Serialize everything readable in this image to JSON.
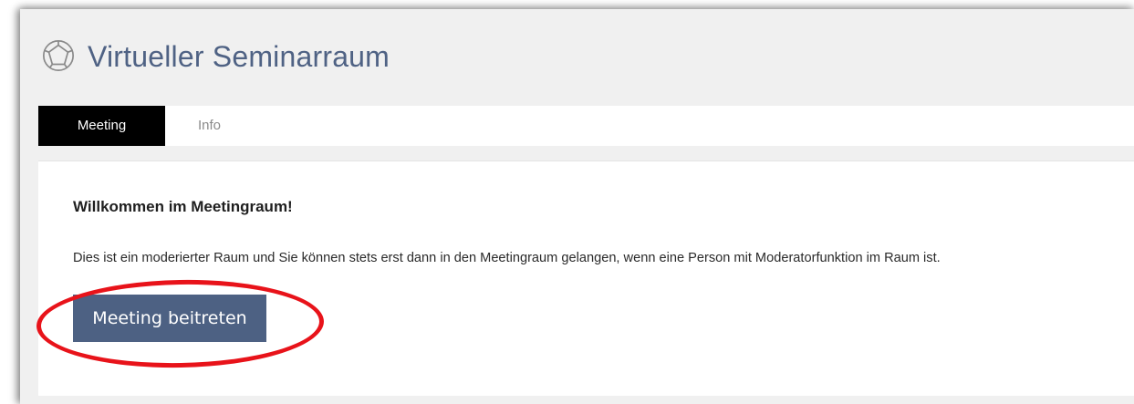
{
  "header": {
    "title": "Virtueller Seminarraum",
    "logo_icon": "network-icon",
    "title_color": "#4f6284"
  },
  "tabs": [
    {
      "label": "Meeting",
      "active": true
    },
    {
      "label": "Info",
      "active": false
    }
  ],
  "main": {
    "heading": "Willkommen im Meetingraum!",
    "description": "Dies ist ein moderierter Raum und Sie können stets erst dann in den Meetingraum gelangen, wenn eine Person mit Moderatorfunktion im Raum ist.",
    "join_button_label": "Meeting beitreten",
    "join_button_color": "#4d6183"
  },
  "annotation": {
    "type": "red-ellipse",
    "color": "#e8131a",
    "target": "join-meeting-button"
  }
}
